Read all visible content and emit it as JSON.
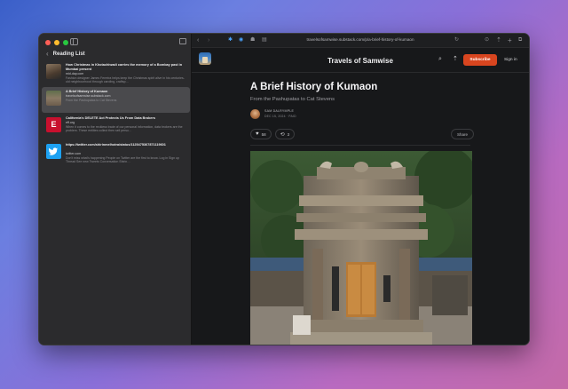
{
  "sidebar": {
    "title": "Reading List",
    "items": [
      {
        "title": "How Christmas in Khotachiwadi carries the memory of a Bombay past in Mumbai present",
        "site": "mid-day.com",
        "desc": "Fashion designer James Ferreira helps keep the Christmas spirit alive in his centuries-old neighbourhood through caroling, craftsp…",
        "thumb_color": "#6b5a4a"
      },
      {
        "title": "A Brief History of Kumaon",
        "site": "travelsofsamwise.substack.com",
        "desc": "From the Pashupatas to Cat Stevens",
        "thumb_color": "#7a6a55"
      },
      {
        "title": "California's DELETE Act Protects Us From Data Brokers",
        "site": "eff.org",
        "desc": "When it comes to the reckless trade of our personal information, data brokers are the problem. These entities collect then sell perso…",
        "thumb_color": "#c8102e"
      },
      {
        "title": "https://twitter.com/shirinmelhotra/status/1125475367871119601",
        "site": "twitter.com",
        "desc": "Don't miss what's happening People on Twitter are the first to know. Log in Sign up Thread See new Tweets Conversation Shirin…",
        "thumb_color": "#1da1f2"
      }
    ]
  },
  "toolbar": {
    "url": "travelsofsamwise.substack.com/p/a-brief-history-of-kumaon"
  },
  "site": {
    "name": "Travels of Samwise",
    "subscribe_label": "Subscribe",
    "signin_label": "Sign in"
  },
  "post": {
    "title": "A Brief History of Kumaon",
    "subtitle": "From the Pashupatas to Cat Stevens",
    "author": "SAM DALRYMPLE",
    "meta": "DEC 15, 2024 · PAID",
    "likes": "58",
    "restacks": "3",
    "share_label": "Share"
  },
  "colors": {
    "accent": "#d8451f",
    "link": "#4aa3ff"
  }
}
